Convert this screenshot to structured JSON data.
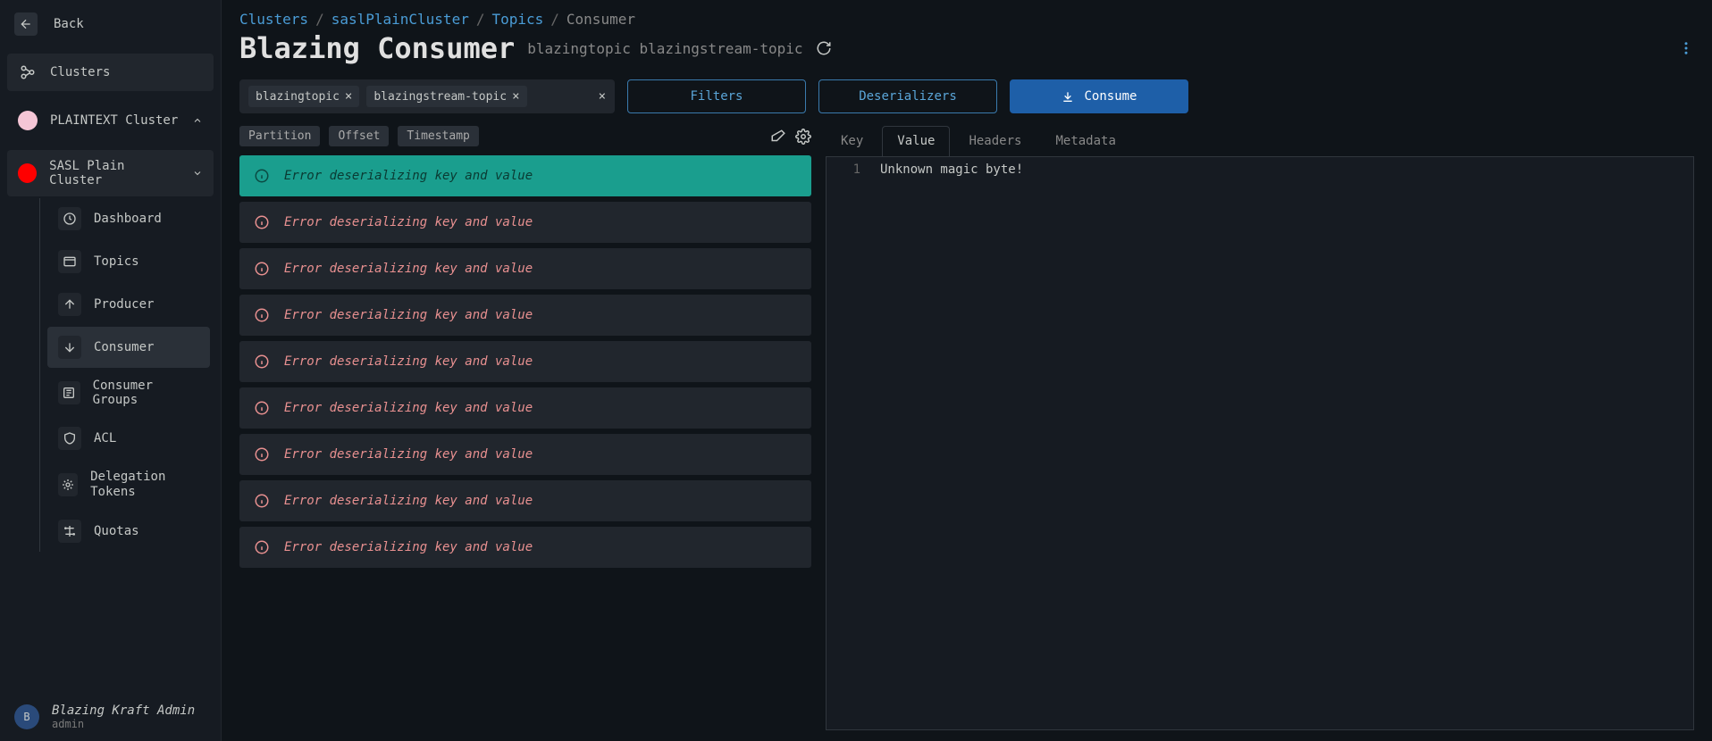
{
  "sidebar": {
    "back_label": "Back",
    "clusters_label": "Clusters",
    "cluster_plaintext": "PLAINTEXT Cluster",
    "cluster_sasl": "SASL Plain Cluster",
    "items": [
      {
        "label": "Dashboard"
      },
      {
        "label": "Topics"
      },
      {
        "label": "Producer"
      },
      {
        "label": "Consumer"
      },
      {
        "label": "Consumer Groups"
      },
      {
        "label": "ACL"
      },
      {
        "label": "Delegation Tokens"
      },
      {
        "label": "Quotas"
      }
    ]
  },
  "user": {
    "initial": "B",
    "name": "Blazing Kraft Admin",
    "role": "admin"
  },
  "breadcrumb": {
    "parts": [
      "Clusters",
      "saslPlainCluster",
      "Topics",
      "Consumer"
    ]
  },
  "title": "Blazing Consumer",
  "title_sub": "blazingtopic blazingstream-topic",
  "chips": [
    "blazingtopic",
    "blazingstream-topic"
  ],
  "buttons": {
    "filters": "Filters",
    "deserializers": "Deserializers",
    "consume": "Consume"
  },
  "columns": [
    "Partition",
    "Offset",
    "Timestamp"
  ],
  "records": [
    {
      "text": "Error deserializing key and value",
      "selected": true
    },
    {
      "text": "Error deserializing key and value",
      "selected": false
    },
    {
      "text": "Error deserializing key and value",
      "selected": false
    },
    {
      "text": "Error deserializing key and value",
      "selected": false
    },
    {
      "text": "Error deserializing key and value",
      "selected": false
    },
    {
      "text": "Error deserializing key and value",
      "selected": false
    },
    {
      "text": "Error deserializing key and value",
      "selected": false
    },
    {
      "text": "Error deserializing key and value",
      "selected": false
    },
    {
      "text": "Error deserializing key and value",
      "selected": false
    }
  ],
  "tabs": [
    "Key",
    "Value",
    "Headers",
    "Metadata"
  ],
  "editor": {
    "line": "1",
    "content": "Unknown magic byte!"
  }
}
